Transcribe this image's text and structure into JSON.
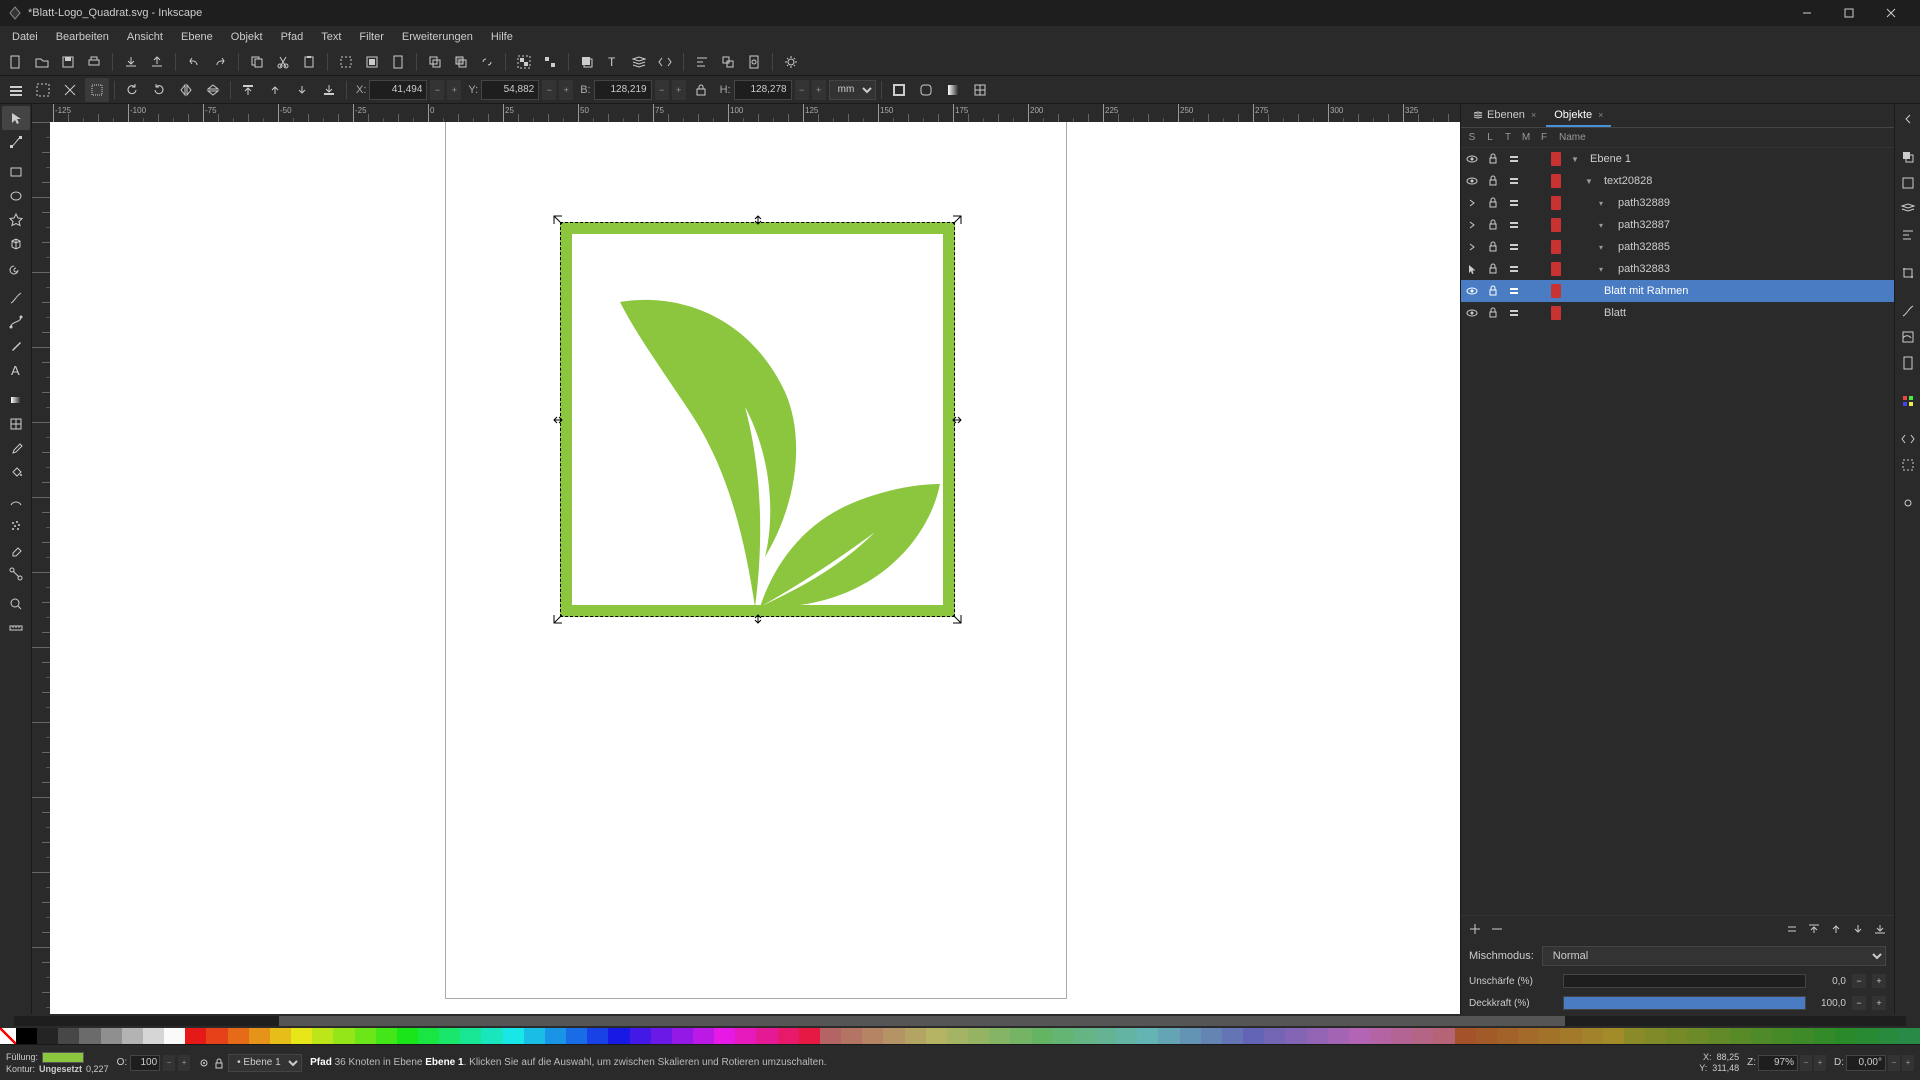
{
  "titlebar": {
    "title": "*Blatt-Logo_Quadrat.svg - Inkscape"
  },
  "menubar": {
    "items": [
      "Datei",
      "Bearbeiten",
      "Ansicht",
      "Ebene",
      "Objekt",
      "Pfad",
      "Text",
      "Filter",
      "Erweiterungen",
      "Hilfe"
    ]
  },
  "tool_options": {
    "x_label": "X:",
    "x_val": "41,494",
    "y_label": "Y:",
    "y_val": "54,882",
    "w_label": "B:",
    "w_val": "128,219",
    "h_label": "H:",
    "h_val": "128,278",
    "unit": "mm"
  },
  "panel_tabs": {
    "layers": "Ebenen",
    "objects": "Objekte"
  },
  "objects_table": {
    "header": {
      "s": "S",
      "l": "L",
      "t": "T",
      "m": "M",
      "f": "F",
      "name": "Name"
    },
    "rows": [
      {
        "indent": 0,
        "expand": "▼",
        "name": "Ebene 1",
        "color": "#c83232",
        "selected": false,
        "vis": "eye"
      },
      {
        "indent": 1,
        "expand": "▼",
        "name": "text20828",
        "color": "#c83232",
        "selected": false,
        "vis": "eye"
      },
      {
        "indent": 2,
        "expand": "▾",
        "name": "path32889",
        "color": "#c83232",
        "selected": false,
        "vis": "chev"
      },
      {
        "indent": 2,
        "expand": "▾",
        "name": "path32887",
        "color": "#c83232",
        "selected": false,
        "vis": "chev"
      },
      {
        "indent": 2,
        "expand": "▾",
        "name": "path32885",
        "color": "#c83232",
        "selected": false,
        "vis": "chev"
      },
      {
        "indent": 2,
        "expand": "▾",
        "name": "path32883",
        "color": "#c83232",
        "selected": false,
        "vis": "cursor"
      },
      {
        "indent": 1,
        "expand": "",
        "name": "Blatt mit Rahmen",
        "color": "#c83232",
        "selected": true,
        "vis": "eye"
      },
      {
        "indent": 1,
        "expand": "",
        "name": "Blatt",
        "color": "#c83232",
        "selected": false,
        "vis": "eye"
      }
    ]
  },
  "blend": {
    "label": "Mischmodus:",
    "value": "Normal"
  },
  "blur": {
    "label": "Unschärfe (%)",
    "value": "0,0"
  },
  "opacity": {
    "label": "Deckkraft (%)",
    "value": "100,0"
  },
  "statusbar": {
    "fill_label": "Füllung:",
    "stroke_label": "Kontur:",
    "stroke_val": "Ungesetzt",
    "stroke_w": "0,227",
    "o_label": "O:",
    "o_val": "100",
    "layer": "Ebene 1",
    "hint_pre": "Pfad",
    "hint_mid": "36 Knoten in Ebene",
    "hint_layer": "Ebene 1",
    "hint_post": ". Klicken Sie auf die Auswahl, um zwischen Skalieren und Rotieren umzuschalten.",
    "x_label": "X:",
    "x_val": "88,25",
    "y_label": "Y:",
    "y_val": "311,48",
    "z_label": "Z:",
    "z_val": "97%",
    "d_label": "D:",
    "d_val": "0,00°"
  },
  "colors": {
    "accent": "#4a7cc4",
    "leaf_green": "#8cc63f",
    "fill_swatch": "#8cc63f"
  }
}
